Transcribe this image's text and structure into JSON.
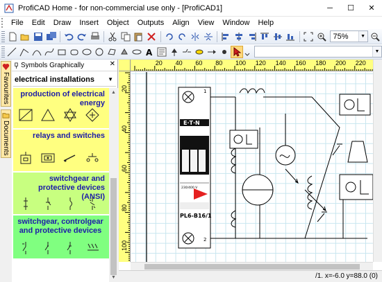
{
  "window": {
    "title": "ProfiCAD Home - for non-commercial use only - [ProfiCAD1]",
    "minimize": "─",
    "maximize": "☐",
    "close": "✕"
  },
  "menu": {
    "items": [
      "File",
      "Edit",
      "Draw",
      "Insert",
      "Object",
      "Outputs",
      "Align",
      "View",
      "Window",
      "Help"
    ]
  },
  "toolbar": {
    "zoom_value": "75%"
  },
  "side_tabs": {
    "favourites": "Favourites",
    "documents": "Documents"
  },
  "panel": {
    "header": "Symbols Graphically",
    "close": "✕",
    "library_value": "electrical installations",
    "categories": [
      {
        "title": "production of electrical energy",
        "color": "#ffff80"
      },
      {
        "title": "relays and switches",
        "color": "#ffff80"
      },
      {
        "title": "switchgear and protective devices (ANSI)",
        "color": "#c8ff80"
      },
      {
        "title": "switchgear, controlgear and protective devices",
        "color": "#80ff80"
      }
    ]
  },
  "rulers": {
    "horizontal": [
      "20",
      "40",
      "60",
      "80",
      "100",
      "120",
      "140",
      "160",
      "180",
      "200",
      "220"
    ],
    "vertical": [
      "20",
      "40",
      "60",
      "80",
      "100"
    ]
  },
  "drawing": {
    "breaker_brand": "E·T·N",
    "breaker_model": "PL6-B16/1",
    "terminal_top": "1",
    "terminal_bottom": "2",
    "voltage_label": "230/400 V"
  },
  "status": {
    "text": "/1.  x=-6.0  y=88.0 (0)"
  },
  "colors": {
    "ruler": "#ffff80",
    "grid": "#c9e6ef",
    "category_title": "#1c1ca8"
  }
}
